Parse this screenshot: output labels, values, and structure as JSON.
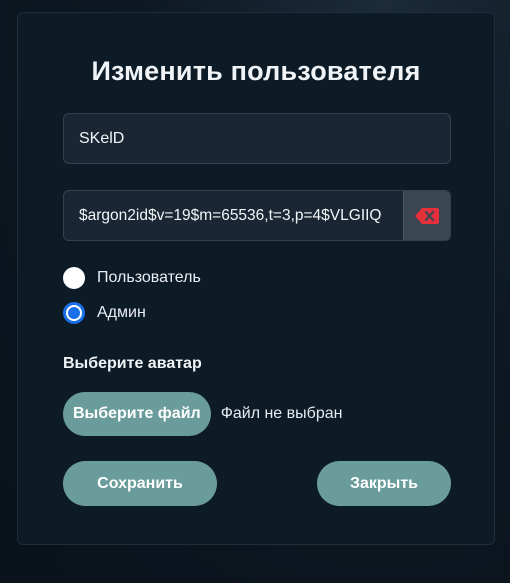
{
  "modal": {
    "title": "Изменить пользователя"
  },
  "fields": {
    "username_value": "SKelD",
    "password_value": "$argon2id$v=19$m=65536,t=3,p=4$VLGIIQ",
    "clear_icon": "backspace-x-icon",
    "clear_icon_color": "#e5303c"
  },
  "roles": [
    {
      "label": "Пользователь",
      "checked": false
    },
    {
      "label": "Админ",
      "checked": true
    }
  ],
  "avatar": {
    "label": "Выберите аватар",
    "choose_button": "Выберите файл",
    "status": "Файл не выбран"
  },
  "actions": {
    "save_label": "Сохранить",
    "close_label": "Закрыть"
  },
  "colors": {
    "button_bg": "#6a9c9c",
    "radio_accent": "#1b6fe8"
  }
}
